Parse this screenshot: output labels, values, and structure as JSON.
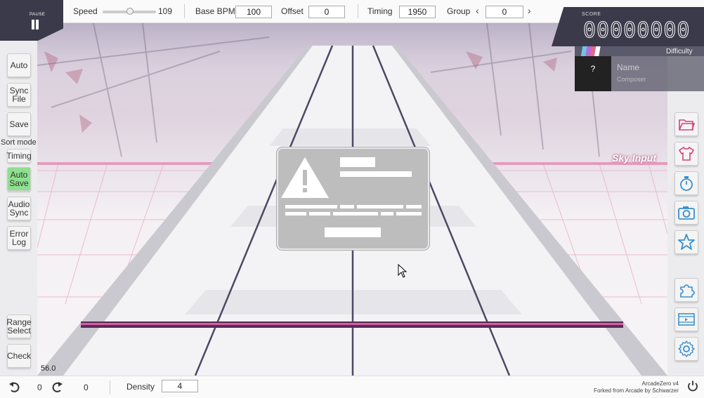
{
  "pause": {
    "label": "PAUSE"
  },
  "toolbar": {
    "speed_label": "Speed",
    "speed_value": "109",
    "base_bpm_label": "Base BPM",
    "base_bpm_value": "100",
    "offset_label": "Offset",
    "offset_value": "0",
    "timing_label": "Timing",
    "timing_value": "1950",
    "group_label": "Group",
    "group_value": "0",
    "group_prev": "‹",
    "group_next": "›"
  },
  "score": {
    "label": "SCORE",
    "value": "00000000"
  },
  "song": {
    "difficulty": "Difficulty",
    "cover_text": "?",
    "name": "Name",
    "composer": "Composer"
  },
  "left_buttons": {
    "auto": "Auto",
    "sync_file": "Sync File",
    "save": "Save",
    "sort_mode_label": "Sort mode",
    "timing": "Timing",
    "auto_save": "Auto Save",
    "audio_sync": "Audio Sync",
    "error_log": "Error Log",
    "range_select": "Range Select",
    "check": "Check"
  },
  "scene": {
    "sky_input": "Sky Input",
    "fps": "56.0"
  },
  "right_buttons": [
    "folder-icon",
    "shirt-icon",
    "stopwatch-icon",
    "camera-icon",
    "star-icon",
    "puzzle-icon",
    "film-icon",
    "gear-icon"
  ],
  "bottom": {
    "undo_count": "0",
    "redo_count": "0",
    "density_label": "Density",
    "density_value": "4",
    "credit_line1": "ArcadeZero v4",
    "credit_line2": "Forked from Arcade by Schwarzer"
  },
  "colors": {
    "panel_dark": "#3a3a4a",
    "active_green": "#8de08d",
    "accent_pink": "#c0407a",
    "icon_blue": "#3a8fd0",
    "icon_pink": "#d8407a"
  }
}
